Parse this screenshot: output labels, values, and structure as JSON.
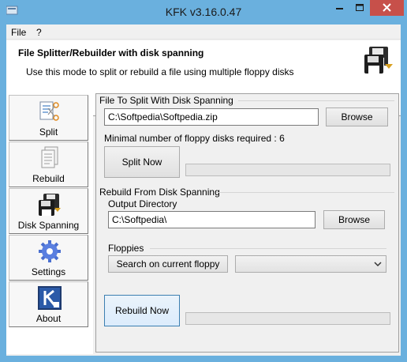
{
  "window": {
    "title": "KFK v3.16.0.47"
  },
  "menu": {
    "file": "File",
    "help": "?"
  },
  "header": {
    "title": "File Splitter/Rebuilder with disk spanning",
    "description": "Use this mode to split or rebuild a file using multiple floppy disks",
    "icon": "floppy-disk-icon"
  },
  "sidebar": {
    "items": [
      {
        "label": "Split",
        "icon": "split-file-icon"
      },
      {
        "label": "Rebuild",
        "icon": "rebuild-file-icon"
      },
      {
        "label": "Disk Spanning",
        "icon": "floppy-disk-icon"
      },
      {
        "label": "Settings",
        "icon": "gear-icon"
      },
      {
        "label": "About",
        "icon": "about-k-icon"
      }
    ]
  },
  "split_group": {
    "title": "File To Split With Disk Spanning",
    "file_path": "C:\\Softpedia\\Softpedia.zip",
    "browse_label": "Browse",
    "floppy_info": "Minimal number of floppy disks required : 6",
    "split_now_label": "Split Now",
    "progress": 0
  },
  "rebuild_group": {
    "title": "Rebuild From Disk Spanning",
    "output_label": "Output Directory",
    "output_path": "C:\\Softpedia\\",
    "browse_label": "Browse",
    "floppies_label": "Floppies",
    "search_label": "Search on current floppy",
    "floppy_select": "",
    "rebuild_now_label": "Rebuild Now",
    "progress": 0
  },
  "colors": {
    "titlebar": "#6ab0de",
    "close_button": "#c7504a",
    "panel_bg": "#f0f0f0"
  }
}
